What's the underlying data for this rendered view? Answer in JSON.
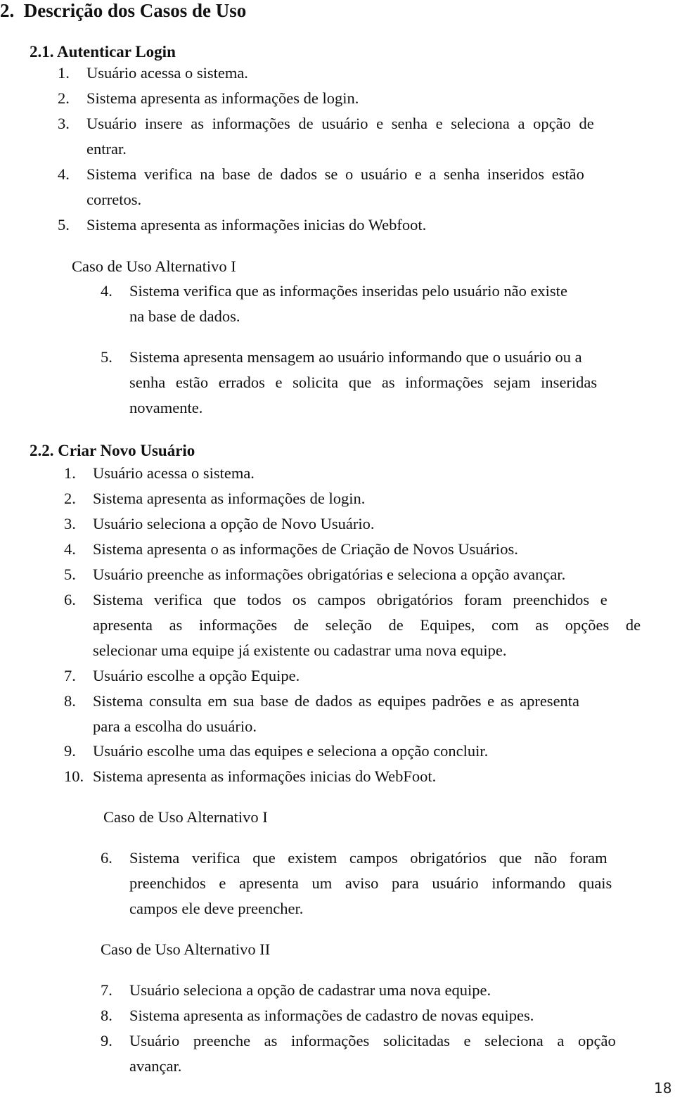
{
  "heading": {
    "number": "2.",
    "title": "Descrição dos Casos de Uso"
  },
  "sections": [
    {
      "number": "2.1.",
      "title": "Autenticar Login",
      "steps": [
        {
          "n": "1.",
          "lines": [
            "Usuário acessa o sistema."
          ]
        },
        {
          "n": "2.",
          "lines": [
            "Sistema apresenta as informações de login."
          ]
        },
        {
          "n": "3.",
          "lines": [
            "Usuário insere as informações de usuário e senha e seleciona a opção de",
            "entrar."
          ]
        },
        {
          "n": "4.",
          "lines": [
            "Sistema verifica na base de dados se o usuário e a senha inseridos estão",
            "corretos."
          ]
        },
        {
          "n": "5.",
          "lines": [
            "Sistema apresenta as informações inicias do Webfoot."
          ]
        }
      ],
      "alternatives": [
        {
          "title": "Caso de Uso Alternativo I",
          "steps": [
            {
              "n": "4.",
              "lines": [
                "Sistema verifica que as informações inseridas pelo usuário não existe",
                "na base de dados."
              ]
            },
            {
              "n": "5.",
              "lines": [
                "Sistema apresenta mensagem ao usuário informando que o usuário ou a",
                "senha estão errados e solicita que as informações sejam inseridas",
                "novamente."
              ]
            }
          ]
        }
      ]
    },
    {
      "number": "2.2.",
      "title": "Criar Novo Usuário",
      "steps": [
        {
          "n": "1.",
          "lines": [
            "Usuário acessa o sistema."
          ]
        },
        {
          "n": "2.",
          "lines": [
            "Sistema apresenta as informações de login."
          ]
        },
        {
          "n": "3.",
          "lines": [
            "Usuário seleciona a opção de Novo Usuário."
          ]
        },
        {
          "n": "4.",
          "lines": [
            "Sistema apresenta o as informações de Criação de Novos Usuários."
          ]
        },
        {
          "n": "5.",
          "lines": [
            "Usuário preenche as informações obrigatórias e seleciona a opção avançar."
          ]
        },
        {
          "n": "6.",
          "lines": [
            "Sistema verifica que todos os campos obrigatórios foram preenchidos e",
            "apresenta as informações de seleção de Equipes, com as opções de",
            "selecionar uma equipe já existente ou cadastrar uma nova equipe."
          ]
        },
        {
          "n": "7.",
          "lines": [
            "Usuário escolhe a opção Equipe."
          ]
        },
        {
          "n": "8.",
          "lines": [
            "Sistema consulta em sua base de dados as equipes padrões e as apresenta",
            "para a escolha do usuário."
          ]
        },
        {
          "n": "9.",
          "lines": [
            "Usuário escolhe uma das equipes e seleciona a opção concluir."
          ]
        },
        {
          "n": "10.",
          "lines": [
            "Sistema apresenta as informações inicias do WebFoot."
          ]
        }
      ],
      "alternatives": [
        {
          "title": "Caso de Uso Alternativo I",
          "steps": [
            {
              "n": "6.",
              "lines": [
                "Sistema verifica que existem campos obrigatórios que não foram",
                "preenchidos e apresenta um aviso para usuário informando quais",
                "campos ele deve preencher."
              ]
            }
          ]
        },
        {
          "title": "Caso de Uso Alternativo II",
          "steps": [
            {
              "n": "7.",
              "lines": [
                "Usuário seleciona a opção de cadastrar uma nova equipe."
              ]
            },
            {
              "n": "8.",
              "lines": [
                "Sistema apresenta as informações de cadastro de novas equipes."
              ]
            },
            {
              "n": "9.",
              "lines": [
                "Usuário preenche as informações solicitadas e seleciona a opção",
                "avançar."
              ]
            }
          ]
        }
      ]
    }
  ],
  "page_number": "18"
}
